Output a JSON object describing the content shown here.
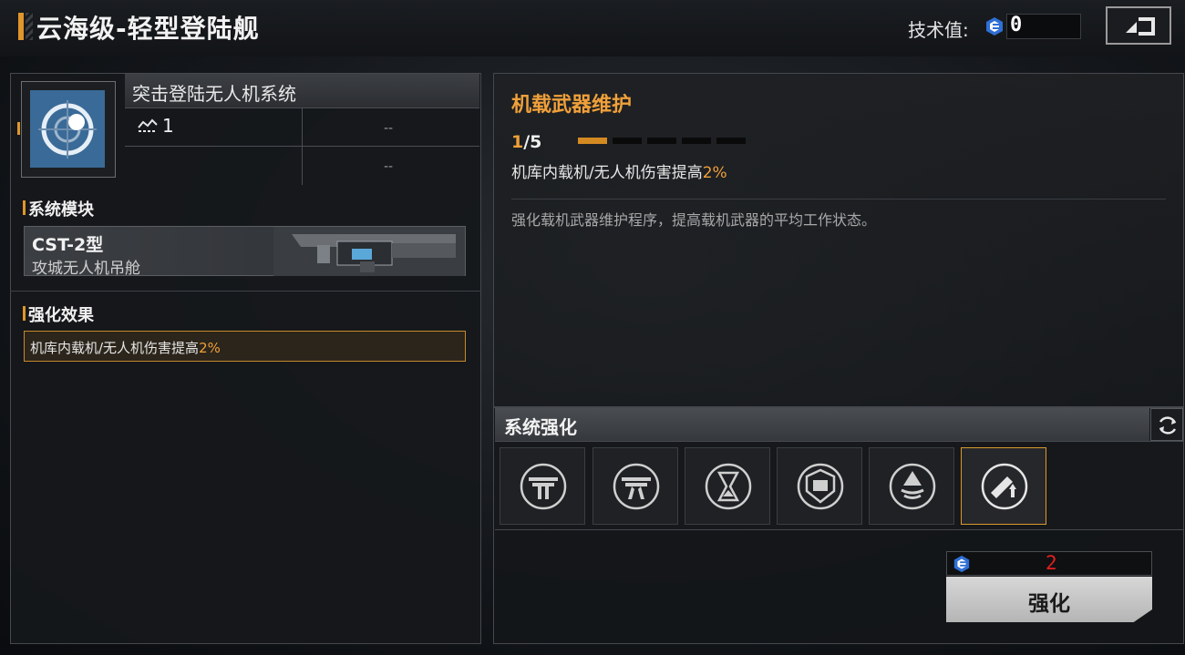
{
  "header": {
    "title": "云海级-轻型登陆舰",
    "tech_label": "技术值:",
    "tech_value": "0"
  },
  "left_panel": {
    "system_name": "突击登陆无人机系统",
    "level": "1",
    "slot_a": "--",
    "slot_b": "--",
    "module_section_title": "系统模块",
    "module_code": "CST-2型",
    "module_name": "攻城无人机吊舱",
    "effect_section_title": "强化效果",
    "effect_prefix": "机库内载机/无人机伤害提高",
    "effect_value": "2%"
  },
  "right_panel": {
    "title": "机载武器维护",
    "progress_current": "1",
    "progress_total": "/5",
    "progress_fraction": 0.2,
    "effect_prefix": "机库内载机/无人机伤害提高",
    "effect_value": "2%",
    "description": "强化载机武器维护程序，提高载机武器的平均工作状态。"
  },
  "system_enhance": {
    "title": "系统强化",
    "slots": [
      {
        "icon": "drone-icon"
      },
      {
        "icon": "drone-alt-icon"
      },
      {
        "icon": "hourglass-icon"
      },
      {
        "icon": "shield-module-icon"
      },
      {
        "icon": "uplift-icon"
      },
      {
        "icon": "weapon-maintenance-icon"
      }
    ],
    "active_slot": 5
  },
  "enhance_action": {
    "cost": "2",
    "button_label": "强化"
  },
  "colors": {
    "accent": "#e0962b",
    "highlight": "#f0a03a",
    "cost_red": "#e02020",
    "icon_blue": "#3a6a97"
  }
}
